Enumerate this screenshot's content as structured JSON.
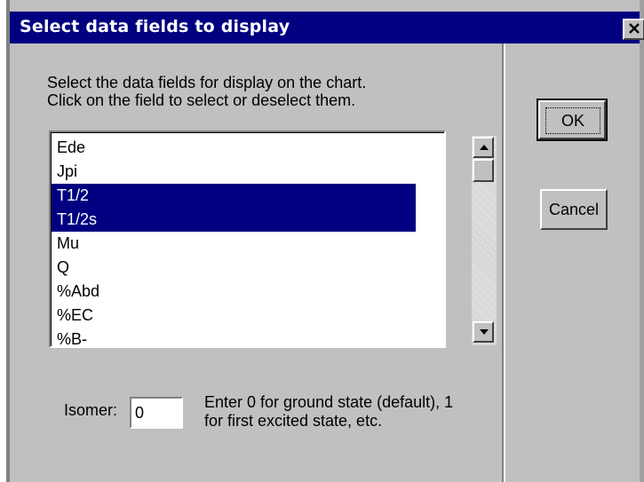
{
  "window": {
    "title": "Select data fields to display",
    "close_icon": "close-x-icon"
  },
  "instructions": "Select the data fields for display on the chart. Click on the field to select or deselect them.",
  "fields": {
    "items": [
      {
        "label": "Ede",
        "selected": false
      },
      {
        "label": "Jpi",
        "selected": false
      },
      {
        "label": "T1/2",
        "selected": true
      },
      {
        "label": "T1/2s",
        "selected": true
      },
      {
        "label": "Mu",
        "selected": false
      },
      {
        "label": "Q",
        "selected": false
      },
      {
        "label": "%Abd",
        "selected": false
      },
      {
        "label": "%EC",
        "selected": false
      },
      {
        "label": "%B-",
        "selected": false
      }
    ],
    "scroll_up_icon": "arrow-up-icon",
    "scroll_down_icon": "arrow-down-icon"
  },
  "buttons": {
    "ok": "OK",
    "cancel": "Cancel"
  },
  "isomer": {
    "label": "Isomer:",
    "value": "0",
    "hint": "Enter 0 for ground state (default), 1 for first excited state, etc."
  },
  "colors": {
    "titlebar": "#000080",
    "selection": "#000080",
    "face": "#c0c0c0"
  }
}
